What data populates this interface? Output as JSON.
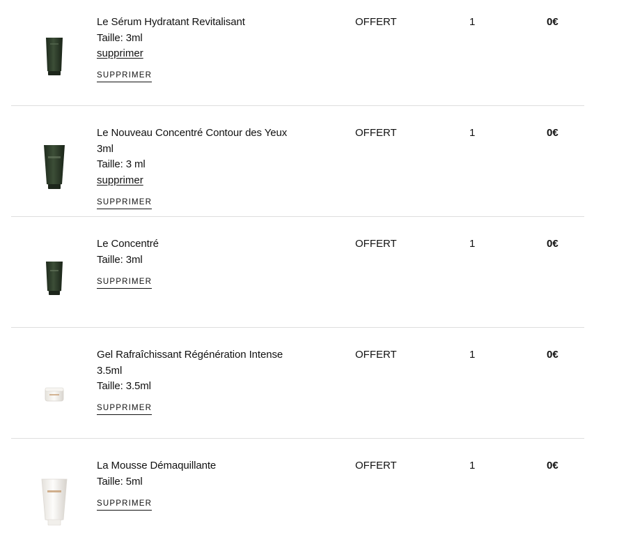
{
  "cart_items": [
    {
      "name": "Le Sérum Hydratant Revitalisant",
      "size": "Taille: 3ml",
      "remove_link": "supprimer",
      "remove_button": "SUPPRIMER",
      "price": "OFFERT",
      "quantity": "1",
      "total": "0€",
      "image": "dark-green-tube-icon"
    },
    {
      "name": "Le Nouveau Concentré Contour des Yeux 3ml",
      "size": "Taille: 3 ml",
      "remove_link": "supprimer",
      "remove_button": "SUPPRIMER",
      "price": "OFFERT",
      "quantity": "1",
      "total": "0€",
      "image": "dark-green-tube-icon"
    },
    {
      "name": "Le Concentré",
      "size": "Taille: 3ml",
      "remove_button": "SUPPRIMER",
      "price": "OFFERT",
      "quantity": "1",
      "total": "0€",
      "image": "dark-green-tube-icon"
    },
    {
      "name": "Gel Rafraîchissant Régénération Intense 3.5ml",
      "size": "Taille: 3.5ml",
      "remove_button": "SUPPRIMER",
      "price": "OFFERT",
      "quantity": "1",
      "total": "0€",
      "image": "white-jar-icon"
    },
    {
      "name": "La Mousse Démaquillante",
      "size": "Taille: 5ml",
      "remove_button": "SUPPRIMER",
      "price": "OFFERT",
      "quantity": "1",
      "total": "0€",
      "image": "white-tube-icon"
    }
  ],
  "colors": {
    "text": "#111111",
    "divider": "#dedede",
    "tube_dark_green": "#2b3a27",
    "tube_white": "#f4f2ee",
    "gold_label": "#c9a27a"
  }
}
